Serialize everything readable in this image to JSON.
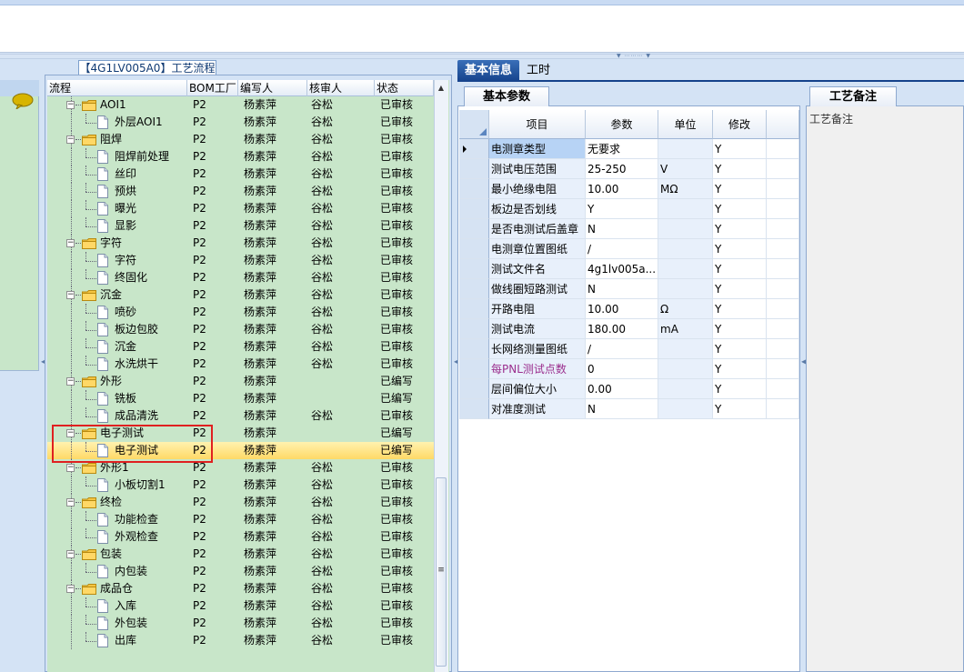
{
  "tree_panel": {
    "title": "【4G1LV005A0】工艺流程",
    "columns": [
      "流程",
      "BOM工厂",
      "编写人",
      "核审人",
      "状态"
    ],
    "rows": [
      {
        "name": "AOI1",
        "level": 1,
        "type": "folder",
        "bom": "P2",
        "writer": "杨素萍",
        "reviewer": "谷松",
        "status": "已审核"
      },
      {
        "name": "外层AOI1",
        "level": 2,
        "type": "doc",
        "bom": "P2",
        "writer": "杨素萍",
        "reviewer": "谷松",
        "status": "已审核"
      },
      {
        "name": "阻焊",
        "level": 1,
        "type": "folder",
        "bom": "P2",
        "writer": "杨素萍",
        "reviewer": "谷松",
        "status": "已审核"
      },
      {
        "name": "阻焊前处理",
        "level": 2,
        "type": "doc",
        "bom": "P2",
        "writer": "杨素萍",
        "reviewer": "谷松",
        "status": "已审核"
      },
      {
        "name": "丝印",
        "level": 2,
        "type": "doc",
        "bom": "P2",
        "writer": "杨素萍",
        "reviewer": "谷松",
        "status": "已审核"
      },
      {
        "name": "预烘",
        "level": 2,
        "type": "doc",
        "bom": "P2",
        "writer": "杨素萍",
        "reviewer": "谷松",
        "status": "已审核"
      },
      {
        "name": "曝光",
        "level": 2,
        "type": "doc",
        "bom": "P2",
        "writer": "杨素萍",
        "reviewer": "谷松",
        "status": "已审核"
      },
      {
        "name": "显影",
        "level": 2,
        "type": "doc",
        "bom": "P2",
        "writer": "杨素萍",
        "reviewer": "谷松",
        "status": "已审核"
      },
      {
        "name": "字符",
        "level": 1,
        "type": "folder",
        "bom": "P2",
        "writer": "杨素萍",
        "reviewer": "谷松",
        "status": "已审核"
      },
      {
        "name": "字符",
        "level": 2,
        "type": "doc",
        "bom": "P2",
        "writer": "杨素萍",
        "reviewer": "谷松",
        "status": "已审核"
      },
      {
        "name": "终固化",
        "level": 2,
        "type": "doc",
        "bom": "P2",
        "writer": "杨素萍",
        "reviewer": "谷松",
        "status": "已审核"
      },
      {
        "name": "沉金",
        "level": 1,
        "type": "folder",
        "bom": "P2",
        "writer": "杨素萍",
        "reviewer": "谷松",
        "status": "已审核"
      },
      {
        "name": "喷砂",
        "level": 2,
        "type": "doc",
        "bom": "P2",
        "writer": "杨素萍",
        "reviewer": "谷松",
        "status": "已审核"
      },
      {
        "name": "板边包胶",
        "level": 2,
        "type": "doc",
        "bom": "P2",
        "writer": "杨素萍",
        "reviewer": "谷松",
        "status": "已审核"
      },
      {
        "name": "沉金",
        "level": 2,
        "type": "doc",
        "bom": "P2",
        "writer": "杨素萍",
        "reviewer": "谷松",
        "status": "已审核"
      },
      {
        "name": "水洗烘干",
        "level": 2,
        "type": "doc",
        "bom": "P2",
        "writer": "杨素萍",
        "reviewer": "谷松",
        "status": "已审核"
      },
      {
        "name": "外形",
        "level": 1,
        "type": "folder",
        "bom": "P2",
        "writer": "杨素萍",
        "reviewer": "",
        "status": "已编写"
      },
      {
        "name": "铣板",
        "level": 2,
        "type": "doc",
        "bom": "P2",
        "writer": "杨素萍",
        "reviewer": "",
        "status": "已编写"
      },
      {
        "name": "成品清洗",
        "level": 2,
        "type": "doc",
        "bom": "P2",
        "writer": "杨素萍",
        "reviewer": "谷松",
        "status": "已审核"
      },
      {
        "name": "电子测试",
        "level": 1,
        "type": "folder",
        "bom": "P2",
        "writer": "杨素萍",
        "reviewer": "",
        "status": "已编写"
      },
      {
        "name": "电子测试",
        "level": 2,
        "type": "doc",
        "bom": "P2",
        "writer": "杨素萍",
        "reviewer": "",
        "status": "已编写",
        "selected": true
      },
      {
        "name": "外形1",
        "level": 1,
        "type": "folder",
        "bom": "P2",
        "writer": "杨素萍",
        "reviewer": "谷松",
        "status": "已审核"
      },
      {
        "name": "小板切割1",
        "level": 2,
        "type": "doc",
        "bom": "P2",
        "writer": "杨素萍",
        "reviewer": "谷松",
        "status": "已审核"
      },
      {
        "name": "终检",
        "level": 1,
        "type": "folder",
        "bom": "P2",
        "writer": "杨素萍",
        "reviewer": "谷松",
        "status": "已审核"
      },
      {
        "name": "功能检查",
        "level": 2,
        "type": "doc",
        "bom": "P2",
        "writer": "杨素萍",
        "reviewer": "谷松",
        "status": "已审核"
      },
      {
        "name": "外观检查",
        "level": 2,
        "type": "doc",
        "bom": "P2",
        "writer": "杨素萍",
        "reviewer": "谷松",
        "status": "已审核"
      },
      {
        "name": "包装",
        "level": 1,
        "type": "folder",
        "bom": "P2",
        "writer": "杨素萍",
        "reviewer": "谷松",
        "status": "已审核"
      },
      {
        "name": "内包装",
        "level": 2,
        "type": "doc",
        "bom": "P2",
        "writer": "杨素萍",
        "reviewer": "谷松",
        "status": "已审核"
      },
      {
        "name": "成品仓",
        "level": 1,
        "type": "folder",
        "bom": "P2",
        "writer": "杨素萍",
        "reviewer": "谷松",
        "status": "已审核"
      },
      {
        "name": "入库",
        "level": 2,
        "type": "doc",
        "bom": "P2",
        "writer": "杨素萍",
        "reviewer": "谷松",
        "status": "已审核"
      },
      {
        "name": "外包装",
        "level": 2,
        "type": "doc",
        "bom": "P2",
        "writer": "杨素萍",
        "reviewer": "谷松",
        "status": "已审核"
      },
      {
        "name": "出库",
        "level": 2,
        "type": "doc",
        "bom": "P2",
        "writer": "杨素萍",
        "reviewer": "谷松",
        "status": "已审核"
      }
    ]
  },
  "main_tabs": {
    "active": "基本信息",
    "other": "工时"
  },
  "params_panel": {
    "subtab": "基本参数",
    "columns": [
      "项目",
      "参数",
      "单位",
      "修改"
    ],
    "rows": [
      {
        "item": "电测章类型",
        "value": "无要求",
        "unit": "",
        "edit": "Y",
        "current": true
      },
      {
        "item": "测试电压范围",
        "value": "25-250",
        "unit": "V",
        "edit": "Y"
      },
      {
        "item": "最小绝缘电阻",
        "value": "10.00",
        "unit": "MΩ",
        "edit": "Y"
      },
      {
        "item": "板边是否划线",
        "value": "Y",
        "unit": "",
        "edit": "Y"
      },
      {
        "item": "是否电测试后盖章",
        "value": "N",
        "unit": "",
        "edit": "Y"
      },
      {
        "item": "电测章位置图纸",
        "value": "/",
        "unit": "",
        "edit": "Y"
      },
      {
        "item": "测试文件名",
        "value": "4g1lv005a...",
        "unit": "",
        "edit": "Y"
      },
      {
        "item": "做线圈短路测试",
        "value": "N",
        "unit": "",
        "edit": "Y"
      },
      {
        "item": "开路电阻",
        "value": "10.00",
        "unit": "Ω",
        "edit": "Y"
      },
      {
        "item": "测试电流",
        "value": "180.00",
        "unit": "mA",
        "edit": "Y"
      },
      {
        "item": "长网络测量图纸",
        "value": "/",
        "unit": "",
        "edit": "Y"
      },
      {
        "item": "每PNL测试点数",
        "value": "0",
        "unit": "",
        "edit": "Y",
        "item_color": "#9b2f8e"
      },
      {
        "item": "层间偏位大小",
        "value": "0.00",
        "unit": "",
        "edit": "Y"
      },
      {
        "item": "对准度测试",
        "value": "N",
        "unit": "",
        "edit": "Y"
      }
    ]
  },
  "notes_panel": {
    "tab": "工艺备注",
    "label": "工艺备注"
  }
}
